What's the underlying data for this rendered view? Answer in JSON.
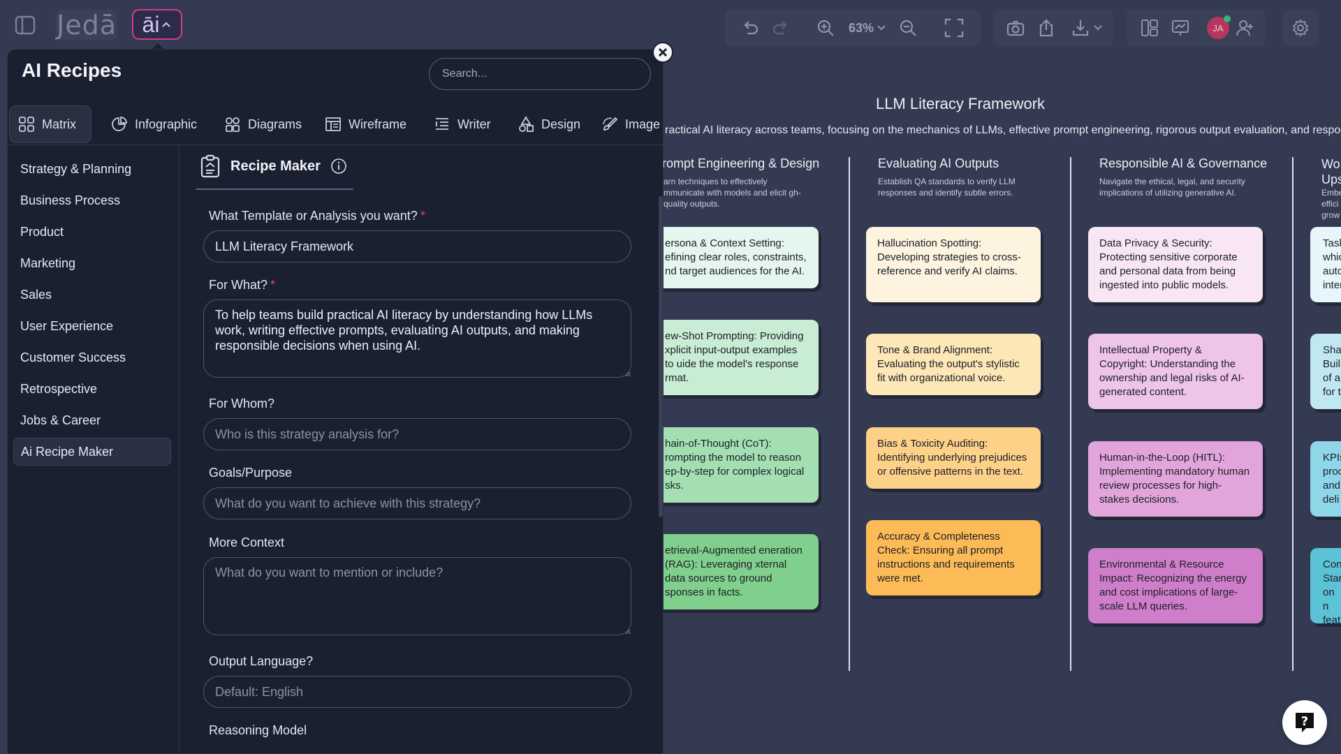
{
  "topbar": {
    "logo_text": "Jedā",
    "ai_logo_text": "āi",
    "zoom": "63%",
    "avatar_initials": "JA"
  },
  "canvas": {
    "title": "LLM Literacy Framework",
    "subtitle": "ractical AI literacy across teams, focusing on the mechanics of LLMs, effective prompt engineering, rigorous output evaluation, and respon",
    "columns": [
      {
        "heading": "rompt Engineering & Design",
        "desc": "arn techniques to effectively mmunicate with models and elicit gh-quality outputs.",
        "cards": [
          "ersona & Context Setting: efining clear roles, constraints, nd target audiences for the AI.",
          "ew-Shot Prompting: Providing xplicit input-output examples to uide the model's response rmat.",
          "hain-of-Thought (CoT): rompting the model to reason ep-by-step for complex logical sks.",
          "etrieval-Augmented eneration (RAG): Leveraging xternal data sources to ground sponses in facts."
        ]
      },
      {
        "heading": "Evaluating AI Outputs",
        "desc": "Establish QA standards to verify LLM responses and identify subtle errors.",
        "cards": [
          "Hallucination Spotting: Developing strategies to cross-reference and verify AI claims.",
          "Tone & Brand Alignment: Evaluating the output's stylistic fit with organizational voice.",
          "Bias & Toxicity Auditing: Identifying underlying prejudices or offensive patterns in the text.",
          "Accuracy & Completeness Check: Ensuring all prompt instructions and requirements were met."
        ]
      },
      {
        "heading": "Responsible AI & Governance",
        "desc": "Navigate the ethical, legal, and security implications of utilizing generative AI.",
        "cards": [
          "Data Privacy & Security: Protecting sensitive corporate and personal data from being ingested into public models.",
          "Intellectual Property & Copyright: Understanding the ownership and legal risks of AI-generated content.",
          "Human-in-the-Loop (HITL): Implementing mandatory human review processes for high-stakes decisions.",
          "Environmental & Resource Impact: Recognizing the energy and cost implications of large-scale LLM queries."
        ]
      },
      {
        "heading": "Wo Ups",
        "desc": "Embe effici grow",
        "cards": [
          "Task whic auto inter",
          "Sha Buil of a for t",
          "KPIs proc and deli",
          "Con Star on n feat"
        ]
      }
    ]
  },
  "panel": {
    "title": "AI Recipes",
    "search_placeholder": "Search...",
    "tabs": [
      "Matrix",
      "Infographic",
      "Diagrams",
      "Wireframe",
      "Writer",
      "Design",
      "Image"
    ],
    "sidebar": [
      "Strategy & Planning",
      "Business Process",
      "Product",
      "Marketing",
      "Sales",
      "User Experience",
      "Customer Success",
      "Retrospective",
      "Jobs & Career",
      "Ai Recipe Maker"
    ],
    "form": {
      "header": "Recipe Maker",
      "template_label": "What Template or Analysis you want?",
      "template_value": "LLM Literacy Framework",
      "forwhat_label": "For What?",
      "forwhat_value": "To help teams build practical AI literacy by understanding how LLMs work, writing effective prompts, evaluating AI outputs, and making responsible decisions when using AI.",
      "forwhom_label": "For Whom?",
      "forwhom_placeholder": "Who is this strategy analysis for?",
      "goals_label": "Goals/Purpose",
      "goals_placeholder": "What do you want to achieve with this strategy?",
      "context_label": "More Context",
      "context_placeholder": "What do you want to mention or include?",
      "language_label": "Output Language?",
      "language_placeholder": "Default: English",
      "model_label": "Reasoning Model",
      "required_mark": "*"
    }
  },
  "colors": {
    "background": "#333a52",
    "panel": "#1b2030",
    "accent_pink": "#d53a8a",
    "required": "#e0435b"
  }
}
